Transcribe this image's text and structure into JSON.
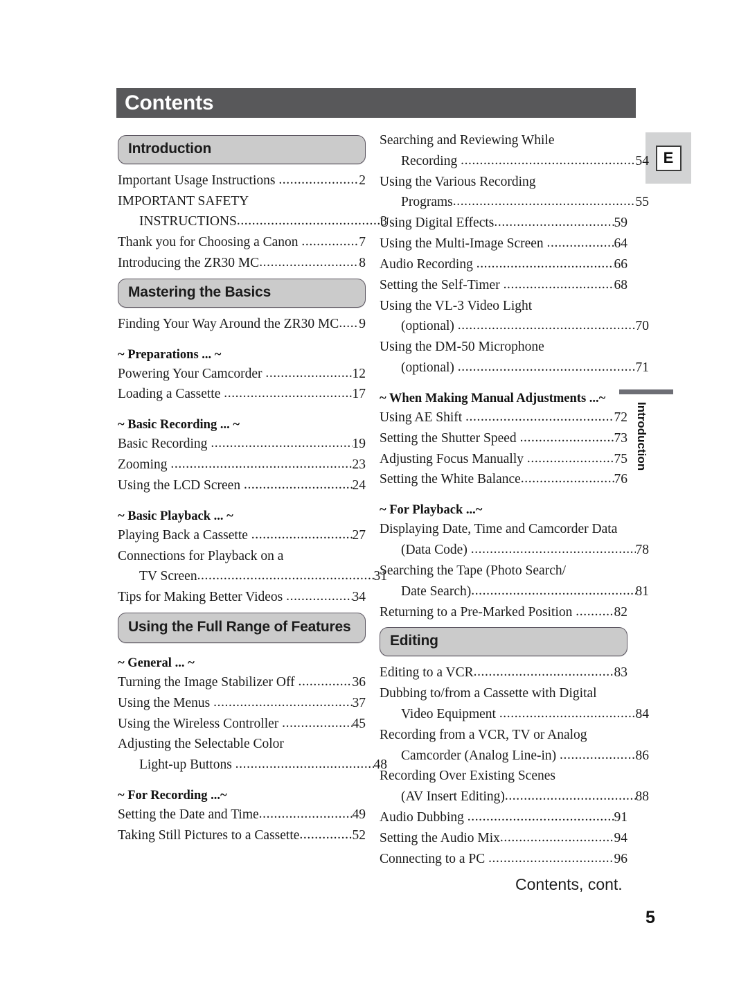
{
  "page": {
    "title": "Contents",
    "language_badge": "E",
    "side_tab_label": "Introduction",
    "footer_note": "Contents, cont.",
    "page_number": "5"
  },
  "colors": {
    "header_bar": "#58585A",
    "section_pill_fill": "#CBCBCB",
    "section_pill_border": "#5B5560",
    "badge_fill": "#D2D3D4",
    "text": "#1A1A1A"
  },
  "left_column": [
    {
      "kind": "pill",
      "label": "Introduction"
    },
    {
      "kind": "entry",
      "lines": [
        "Important Usage Instructions "
      ],
      "page": "2"
    },
    {
      "kind": "entry",
      "lines": [
        "IMPORTANT SAFETY",
        "INSTRUCTIONS"
      ],
      "page": "3"
    },
    {
      "kind": "entry",
      "lines": [
        "Thank you for Choosing a Canon "
      ],
      "page": "7"
    },
    {
      "kind": "entry",
      "lines": [
        "Introducing the ZR30 MC"
      ],
      "page": "8"
    },
    {
      "kind": "pill",
      "label": "Mastering the Basics"
    },
    {
      "kind": "entry",
      "lines": [
        "Finding Your Way Around the ZR30 MC"
      ],
      "page": "9",
      "short_leader": true
    },
    {
      "kind": "subhead",
      "label": "~ Preparations ... ~"
    },
    {
      "kind": "entry",
      "lines": [
        "Powering Your Camcorder "
      ],
      "page": "12"
    },
    {
      "kind": "entry",
      "lines": [
        "Loading a Cassette "
      ],
      "page": "17"
    },
    {
      "kind": "subhead",
      "label": "~ Basic Recording ... ~"
    },
    {
      "kind": "entry",
      "lines": [
        "Basic Recording "
      ],
      "page": "19"
    },
    {
      "kind": "entry",
      "lines": [
        "Zooming "
      ],
      "page": "23"
    },
    {
      "kind": "entry",
      "lines": [
        "Using the LCD Screen "
      ],
      "page": "24"
    },
    {
      "kind": "subhead",
      "label": "~ Basic Playback ... ~"
    },
    {
      "kind": "entry",
      "lines": [
        "Playing Back a Cassette "
      ],
      "page": "27"
    },
    {
      "kind": "entry",
      "lines": [
        "Connections for Playback on a",
        "TV Screen"
      ],
      "page": "31"
    },
    {
      "kind": "entry",
      "lines": [
        "Tips for Making Better Videos "
      ],
      "page": "34"
    },
    {
      "kind": "pill",
      "label": "Using the Full Range of Features",
      "two_line": true
    },
    {
      "kind": "subhead",
      "label": "~ General ... ~"
    },
    {
      "kind": "entry",
      "lines": [
        "Turning the Image Stabilizer Off "
      ],
      "page": "36"
    },
    {
      "kind": "entry",
      "lines": [
        "Using the Menus "
      ],
      "page": "37"
    },
    {
      "kind": "entry",
      "lines": [
        "Using the Wireless Controller "
      ],
      "page": "45"
    },
    {
      "kind": "entry",
      "lines": [
        "Adjusting the Selectable Color",
        "Light-up Buttons "
      ],
      "page": "48"
    },
    {
      "kind": "subhead",
      "label": "~ For Recording ...~"
    },
    {
      "kind": "entry",
      "lines": [
        "Setting the Date and Time"
      ],
      "page": "49"
    },
    {
      "kind": "entry",
      "lines": [
        "Taking Still Pictures to a Cassette"
      ],
      "page": "52"
    }
  ],
  "right_column": [
    {
      "kind": "entry",
      "lines": [
        "Searching and Reviewing While",
        "Recording "
      ],
      "page": "54"
    },
    {
      "kind": "entry",
      "lines": [
        "Using the Various Recording",
        "Programs"
      ],
      "page": "55"
    },
    {
      "kind": "entry",
      "lines": [
        "Using Digital Effects"
      ],
      "page": "59"
    },
    {
      "kind": "entry",
      "lines": [
        "Using the Multi-Image Screen "
      ],
      "page": "64"
    },
    {
      "kind": "entry",
      "lines": [
        "Audio Recording "
      ],
      "page": "66"
    },
    {
      "kind": "entry",
      "lines": [
        "Setting the Self-Timer "
      ],
      "page": "68"
    },
    {
      "kind": "entry",
      "lines": [
        "Using the VL-3 Video Light",
        "(optional) "
      ],
      "page": "70"
    },
    {
      "kind": "entry",
      "lines": [
        "Using the DM-50 Microphone",
        "(optional) "
      ],
      "page": "71"
    },
    {
      "kind": "subhead",
      "label": "~ When Making Manual Adjustments ...~"
    },
    {
      "kind": "entry",
      "lines": [
        "Using AE Shift "
      ],
      "page": "72"
    },
    {
      "kind": "entry",
      "lines": [
        "Setting the Shutter Speed "
      ],
      "page": "73"
    },
    {
      "kind": "entry",
      "lines": [
        "Adjusting Focus Manually "
      ],
      "page": "75"
    },
    {
      "kind": "entry",
      "lines": [
        "Setting the White Balance"
      ],
      "page": "76"
    },
    {
      "kind": "subhead",
      "label": "~ For Playback ...~"
    },
    {
      "kind": "entry",
      "lines": [
        "Displaying Date, Time and Camcorder Data",
        "(Data Code) "
      ],
      "page": "78"
    },
    {
      "kind": "entry",
      "lines": [
        "Searching the Tape (Photo Search/",
        "Date Search)"
      ],
      "page": "81"
    },
    {
      "kind": "entry",
      "lines": [
        "Returning to a Pre-Marked Position "
      ],
      "page": "82"
    },
    {
      "kind": "pill",
      "label": "Editing"
    },
    {
      "kind": "entry",
      "lines": [
        "Editing to a VCR"
      ],
      "page": "83"
    },
    {
      "kind": "entry",
      "lines": [
        "Dubbing to/from a Cassette with Digital",
        "Video Equipment "
      ],
      "page": "84"
    },
    {
      "kind": "entry",
      "lines": [
        "Recording from a VCR, TV or Analog",
        "Camcorder (Analog Line-in) "
      ],
      "page": "86"
    },
    {
      "kind": "entry",
      "lines": [
        "Recording Over Existing Scenes",
        "(AV Insert Editing)"
      ],
      "page": "88"
    },
    {
      "kind": "entry",
      "lines": [
        "Audio Dubbing "
      ],
      "page": "91"
    },
    {
      "kind": "entry",
      "lines": [
        "Setting the Audio Mix"
      ],
      "page": "94"
    },
    {
      "kind": "entry",
      "lines": [
        "Connecting to a PC "
      ],
      "page": "96"
    }
  ]
}
